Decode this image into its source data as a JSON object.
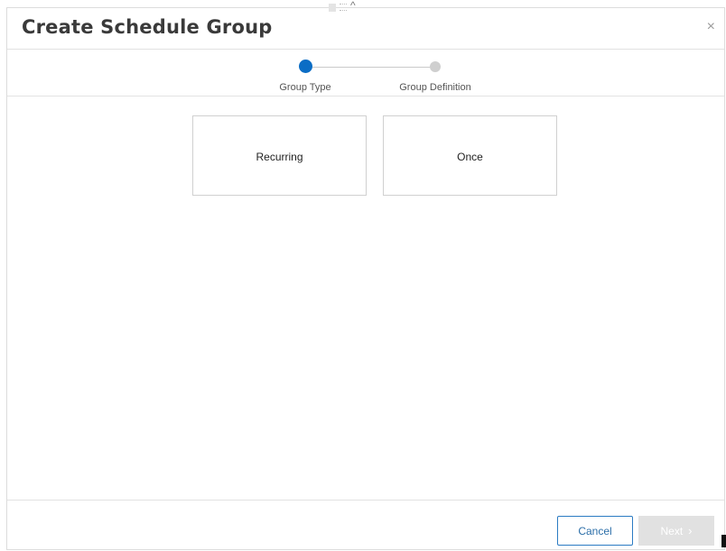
{
  "dialog": {
    "title": "Create Schedule Group",
    "close_glyph": "×"
  },
  "drag_handle": {
    "icon": "drag-handle-icon",
    "chevron_glyph": "^"
  },
  "stepper": {
    "steps": [
      {
        "label": "Group Type",
        "state": "active"
      },
      {
        "label": "Group Definition",
        "state": "inactive"
      }
    ],
    "active_color": "#0b6dc5",
    "inactive_color": "#cfcfcf"
  },
  "options": [
    {
      "label": "Recurring"
    },
    {
      "label": "Once"
    }
  ],
  "footer": {
    "cancel_label": "Cancel",
    "next_label": "Next",
    "next_glyph": "›"
  }
}
